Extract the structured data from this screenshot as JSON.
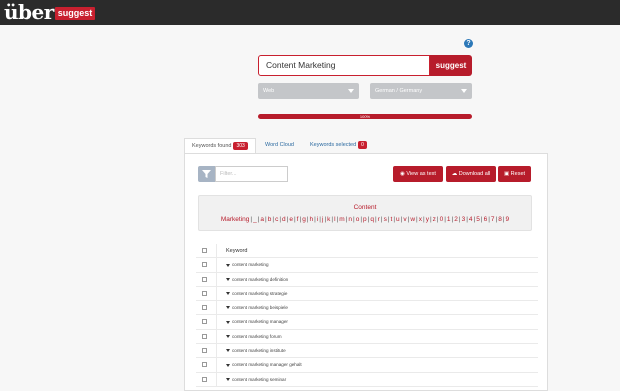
{
  "brand": {
    "logo_main": "über",
    "logo_badge": "suggest"
  },
  "help": {
    "glyph": "?"
  },
  "search": {
    "value": "Content Marketing",
    "button_label": "suggest"
  },
  "selects": {
    "source": "Web",
    "language": "German / Germany"
  },
  "progress": {
    "label": "100%",
    "value": 1.0
  },
  "tabs": [
    {
      "label": "Keywords found",
      "badge": "303"
    },
    {
      "label": "Word Cloud"
    },
    {
      "label": "Keywords selected",
      "badge": "0"
    }
  ],
  "filter": {
    "placeholder": "Filter..."
  },
  "actions": {
    "view_text": "View as text",
    "download_all": "Download all",
    "reset": "Reset"
  },
  "alphabet": {
    "prefix": "Content Marketing",
    "letters": [
      "_",
      "a",
      "b",
      "c",
      "d",
      "e",
      "f",
      "g",
      "h",
      "i",
      "j",
      "k",
      "l",
      "m",
      "n",
      "o",
      "p",
      "q",
      "r",
      "s",
      "t",
      "u",
      "v",
      "w",
      "x",
      "y",
      "z",
      "0",
      "1",
      "2",
      "3",
      "4",
      "5",
      "6",
      "7",
      "8",
      "9"
    ]
  },
  "table": {
    "header": "Keyword",
    "rows": [
      "content marketing",
      "content marketing definition",
      "content marketing strategie",
      "content marketing beispiele",
      "content marketing manager",
      "content marketing forum",
      "content marketing institute",
      "content marketing manager gehalt",
      "content marketing seminar"
    ]
  }
}
